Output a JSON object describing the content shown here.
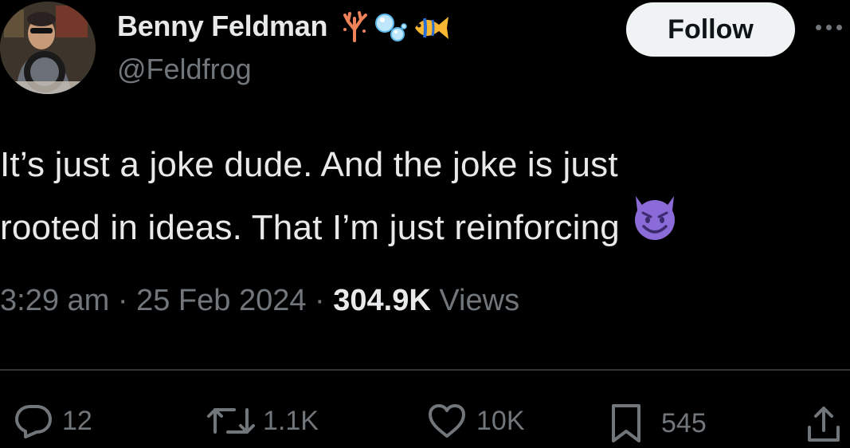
{
  "author": {
    "display_name": "Benny Feldman",
    "handle": "@Feldfrog",
    "name_emoji": [
      "coral-icon",
      "bubbles-icon",
      "tropical-fish-icon"
    ]
  },
  "header": {
    "follow_label": "Follow",
    "more_icon": "more-icon"
  },
  "tweet": {
    "line1": "It’s just a joke dude. And the joke is just",
    "line2": "rooted in ideas. That I’m just reinforcing",
    "trailing_emoji": "smiling-devil-icon"
  },
  "meta": {
    "time": "3:29 am",
    "separator": " · ",
    "date": "25 Feb 2024",
    "views_count": "304.9K",
    "views_label": " Views"
  },
  "actions": {
    "replies": "12",
    "reposts": "1.1K",
    "likes": "10K",
    "bookmarks": "545",
    "share_icon": "share-icon"
  },
  "colors": {
    "background": "#000000",
    "text": "#e7e9ea",
    "secondary": "#71767b",
    "follow_bg": "#eff3f4",
    "divider": "#2f3336",
    "devil": "#8b6bd8"
  }
}
